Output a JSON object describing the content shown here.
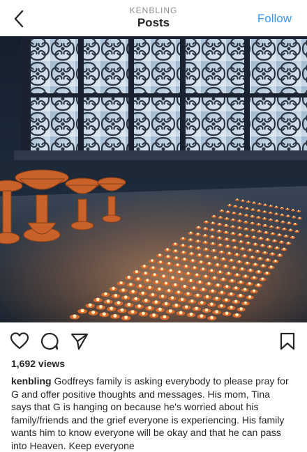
{
  "header": {
    "username": "KENBLING",
    "title": "Posts",
    "follow_label": "Follow",
    "back_icon": "chevron-left-icon"
  },
  "post": {
    "image_alt": "Butter lamps lit on a table beneath ornate latticed windows",
    "actions": {
      "like_icon": "heart-icon",
      "comment_icon": "comment-icon",
      "share_icon": "paper-plane-icon",
      "save_icon": "bookmark-icon"
    },
    "views": "1,692 views",
    "caption_user": "kenbling",
    "caption_text": "Godfreys family is asking everybody to please pray for G and offer positive thoughts and messages.  His mom, Tina says that G is hanging on because he's worried about his family/friends and the grief everyone is experiencing.  His family wants him to know everyone will be okay and that he can pass into Heaven.  Keep everyone"
  },
  "colors": {
    "accent": "#3897f0",
    "text": "#262626",
    "muted": "#8e8e8e"
  }
}
